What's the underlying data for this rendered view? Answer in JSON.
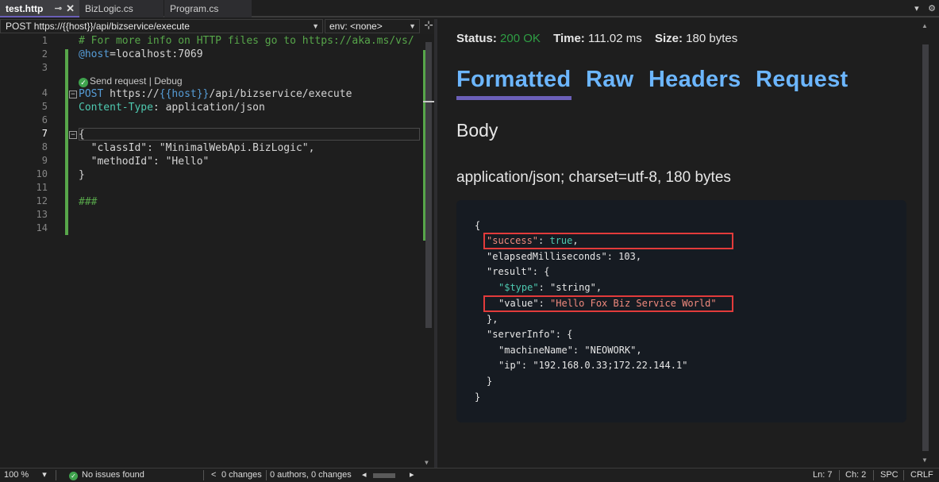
{
  "tabs": [
    {
      "label": "test.http",
      "active": true
    },
    {
      "label": "BizLogic.cs",
      "active": false
    },
    {
      "label": "Program.cs",
      "active": false
    }
  ],
  "tab_icons": {
    "pin": "pin-icon",
    "close": "close-icon"
  },
  "tabbar_right": {
    "dropdown": "chevron-down-icon",
    "settings": "gear-icon"
  },
  "editor_toolbar": {
    "request_select": "POST https://{{host}}/api/bizservice/execute",
    "env_select": "env: <none>"
  },
  "editor": {
    "line_numbers": [
      "1",
      "2",
      "3",
      "4",
      "5",
      "6",
      "7",
      "8",
      "9",
      "10",
      "11",
      "12",
      "13",
      "14"
    ],
    "current_line": "7",
    "codelens": {
      "send": "Send request",
      "sep": "|",
      "debug": "Debug"
    },
    "lines": {
      "l1": "# For more info on HTTP files go to https://aka.ms/vs/",
      "l2_var": "@host",
      "l2_rest": "=localhost:7069",
      "l4_method": "POST",
      "l4_url_a": " https://",
      "l4_url_b": "{{host}}",
      "l4_url_c": "/api/bizservice/execute",
      "l5_hdr": "Content-Type",
      "l5_val": ": application/json",
      "l7": "{",
      "l8": "  \"classId\": \"MinimalWebApi.BizLogic\",",
      "l9": "  \"methodId\": \"Hello\"",
      "l10": "}",
      "l12": "###"
    }
  },
  "response": {
    "status_label": "Status:",
    "status_value": "200 OK",
    "time_label": "Time:",
    "time_value": "111.02 ms",
    "size_label": "Size:",
    "size_value": "180 bytes",
    "tabs": [
      "Formatted",
      "Raw",
      "Headers",
      "Request"
    ],
    "active_tab": "Formatted",
    "body_heading": "Body",
    "content_type": "application/json; charset=utf-8, 180 bytes",
    "json": {
      "open": "{",
      "success_key": "\"success\"",
      "success_val": "true",
      "elapsed_key": "\"elapsedMilliseconds\"",
      "elapsed_val": "103",
      "result_key": "\"result\"",
      "type_key": "\"$type\"",
      "type_val": "\"string\"",
      "value_key": "\"value\"",
      "value_val": "\"Hello Fox Biz Service World\"",
      "result_close": "},",
      "server_key": "\"serverInfo\"",
      "machine_key": "\"machineName\"",
      "machine_val": "\"NEOWORK\"",
      "ip_key": "\"ip\"",
      "ip_val": "\"192.168.0.33;172.22.144.1\"",
      "server_close": "}",
      "close": "}"
    }
  },
  "statusbar": {
    "zoom": "100 %",
    "issues": "No issues found",
    "changes": "0 changes",
    "authors": "0 authors, 0 changes",
    "ln": "Ln: 7",
    "ch": "Ch: 2",
    "spc": "SPC",
    "crlf": "CRLF"
  }
}
